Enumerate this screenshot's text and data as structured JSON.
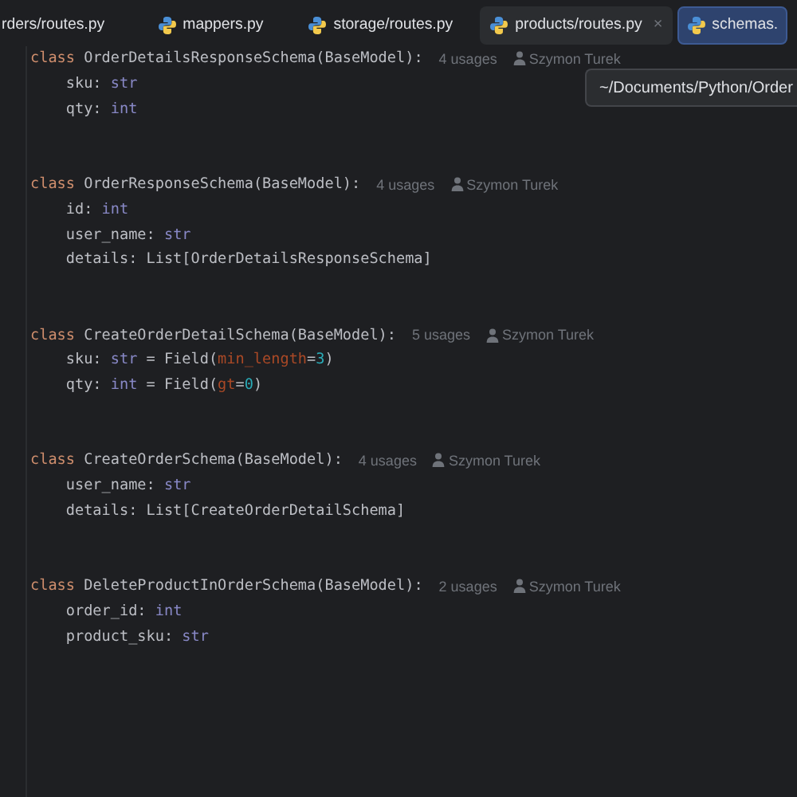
{
  "tabs": [
    {
      "label": "rders/routes.py",
      "selected": false,
      "hovered": false,
      "icon": false
    },
    {
      "label": "mappers.py",
      "selected": false,
      "hovered": false,
      "icon": true
    },
    {
      "label": "storage/routes.py",
      "selected": false,
      "hovered": false,
      "icon": true
    },
    {
      "label": "products/routes.py",
      "selected": false,
      "hovered": true,
      "icon": true,
      "close": "×"
    },
    {
      "label": "schemas.",
      "selected": true,
      "hovered": false,
      "icon": true
    }
  ],
  "tooltip": "~/Documents/Python/Order",
  "lines": [
    {
      "kind": "code",
      "tokens": [
        {
          "kind": "keyword",
          "text": "class "
        },
        {
          "kind": "plain",
          "text": "OrderDetailsResponseSchema(BaseModel):"
        }
      ],
      "usages": "4 usages",
      "author": "Szymon Turek"
    },
    {
      "kind": "code",
      "tokens": [
        {
          "kind": "plain",
          "text": "    sku: "
        },
        {
          "kind": "type",
          "text": "str"
        }
      ]
    },
    {
      "kind": "code",
      "tokens": [
        {
          "kind": "plain",
          "text": "    qty: "
        },
        {
          "kind": "type",
          "text": "int"
        }
      ]
    },
    {
      "kind": "blank"
    },
    {
      "kind": "blank"
    },
    {
      "kind": "code",
      "tokens": [
        {
          "kind": "keyword",
          "text": "class "
        },
        {
          "kind": "plain",
          "text": "OrderResponseSchema(BaseModel):"
        }
      ],
      "usages": "4 usages",
      "author": "Szymon Turek"
    },
    {
      "kind": "code",
      "tokens": [
        {
          "kind": "plain",
          "text": "    id: "
        },
        {
          "kind": "type",
          "text": "int"
        }
      ]
    },
    {
      "kind": "code",
      "tokens": [
        {
          "kind": "plain",
          "text": "    user_name: "
        },
        {
          "kind": "type",
          "text": "str"
        }
      ]
    },
    {
      "kind": "code",
      "tokens": [
        {
          "kind": "plain",
          "text": "    details: List[OrderDetailsResponseSchema]"
        }
      ]
    },
    {
      "kind": "blank"
    },
    {
      "kind": "blank"
    },
    {
      "kind": "code",
      "tokens": [
        {
          "kind": "keyword",
          "text": "class "
        },
        {
          "kind": "plain",
          "text": "CreateOrderDetailSchema(BaseModel):"
        }
      ],
      "usages": "5 usages",
      "author": "Szymon Turek"
    },
    {
      "kind": "code",
      "tokens": [
        {
          "kind": "plain",
          "text": "    sku: "
        },
        {
          "kind": "type",
          "text": "str"
        },
        {
          "kind": "plain",
          "text": " = Field("
        },
        {
          "kind": "param",
          "text": "min_length"
        },
        {
          "kind": "plain",
          "text": "="
        },
        {
          "kind": "number",
          "text": "3"
        },
        {
          "kind": "plain",
          "text": ")"
        }
      ]
    },
    {
      "kind": "code",
      "tokens": [
        {
          "kind": "plain",
          "text": "    qty: "
        },
        {
          "kind": "type",
          "text": "int"
        },
        {
          "kind": "plain",
          "text": " = Field("
        },
        {
          "kind": "param",
          "text": "gt"
        },
        {
          "kind": "plain",
          "text": "="
        },
        {
          "kind": "number",
          "text": "0"
        },
        {
          "kind": "plain",
          "text": ")"
        }
      ]
    },
    {
      "kind": "blank"
    },
    {
      "kind": "blank"
    },
    {
      "kind": "code",
      "tokens": [
        {
          "kind": "keyword",
          "text": "class "
        },
        {
          "kind": "plain",
          "text": "CreateOrderSchema(BaseModel):"
        }
      ],
      "usages": "4 usages",
      "author": "Szymon Turek"
    },
    {
      "kind": "code",
      "tokens": [
        {
          "kind": "plain",
          "text": "    user_name: "
        },
        {
          "kind": "type",
          "text": "str"
        }
      ]
    },
    {
      "kind": "code",
      "tokens": [
        {
          "kind": "plain",
          "text": "    details: List[CreateOrderDetailSchema]"
        }
      ]
    },
    {
      "kind": "blank"
    },
    {
      "kind": "blank"
    },
    {
      "kind": "code",
      "tokens": [
        {
          "kind": "keyword",
          "text": "class "
        },
        {
          "kind": "plain",
          "text": "DeleteProductInOrderSchema(BaseModel):"
        }
      ],
      "usages": "2 usages",
      "author": "Szymon Turek"
    },
    {
      "kind": "code",
      "tokens": [
        {
          "kind": "plain",
          "text": "    order_id: "
        },
        {
          "kind": "type",
          "text": "int"
        }
      ]
    },
    {
      "kind": "code",
      "tokens": [
        {
          "kind": "plain",
          "text": "    product_sku: "
        },
        {
          "kind": "type",
          "text": "str"
        }
      ]
    }
  ]
}
